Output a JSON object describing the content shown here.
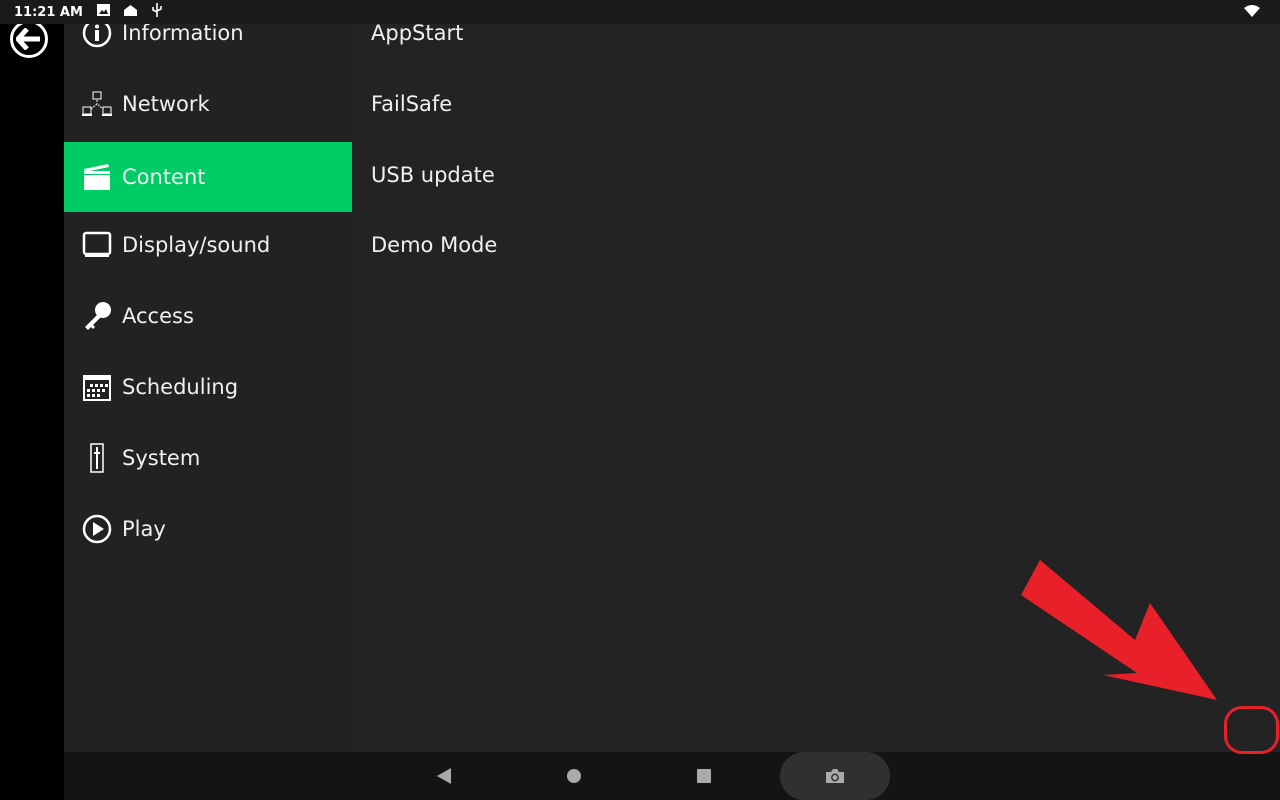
{
  "status_bar": {
    "time": "11:21 AM",
    "icons": [
      "image-icon",
      "home-icon",
      "usb-icon",
      "wifi-icon"
    ]
  },
  "back_button": {
    "icon": "arrow-left-circle-icon"
  },
  "menu": {
    "items": [
      {
        "label": "Information",
        "icon": "info-icon"
      },
      {
        "label": "Network",
        "icon": "network-icon"
      },
      {
        "label": "Content",
        "icon": "clapperboard-icon",
        "active": true
      },
      {
        "label": "Display/sound",
        "icon": "monitor-icon"
      },
      {
        "label": "Access",
        "icon": "key-icon"
      },
      {
        "label": "Scheduling",
        "icon": "calendar-icon"
      },
      {
        "label": "System",
        "icon": "slider-icon"
      },
      {
        "label": "Play",
        "icon": "play-icon"
      }
    ]
  },
  "submenu": {
    "items": [
      "AppStart",
      "FailSafe",
      "USB update",
      "Demo Mode"
    ]
  },
  "navbar": {
    "icons": [
      "back-icon",
      "home-icon",
      "recents-icon",
      "camera-icon"
    ]
  },
  "annotation": {
    "color": "#e8202a"
  },
  "colors": {
    "accent": "#00cc66"
  }
}
